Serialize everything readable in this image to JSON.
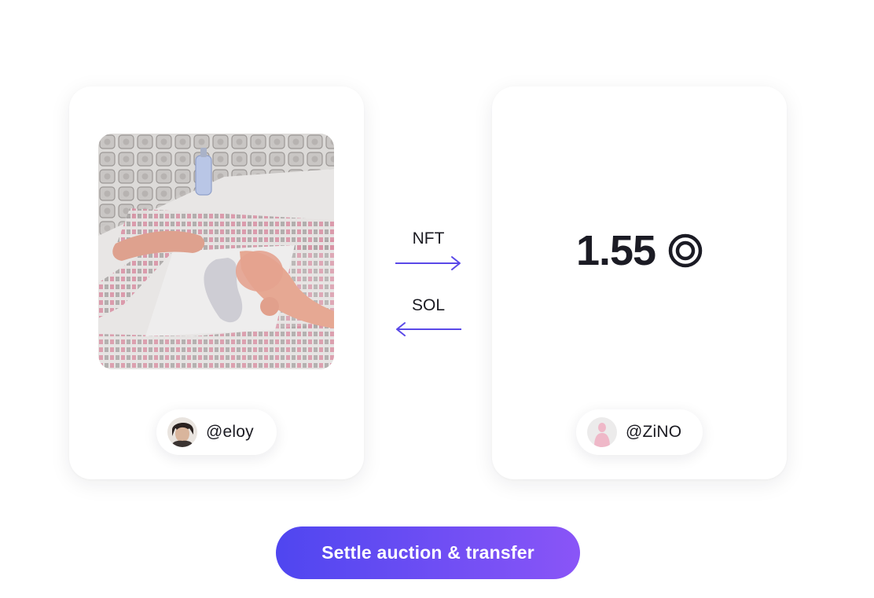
{
  "left_card": {
    "artwork_icon": "nft-artwork-image",
    "seller": {
      "handle": "@eloy",
      "avatar_icon": "seller-avatar"
    }
  },
  "transfer": {
    "nft_label": "NFT",
    "sol_label": "SOL",
    "nft_arrow_icon": "arrow-right-icon",
    "sol_arrow_icon": "arrow-left-icon",
    "arrow_color": "#5a49e8"
  },
  "right_card": {
    "price": "1.55",
    "currency_icon": "solana-coin-icon",
    "buyer": {
      "handle": "@ZiNO",
      "avatar_icon": "buyer-avatar"
    }
  },
  "action": {
    "settle_label": "Settle auction & transfer",
    "gradient_start": "#4f46f0",
    "gradient_end": "#8a55f7"
  }
}
